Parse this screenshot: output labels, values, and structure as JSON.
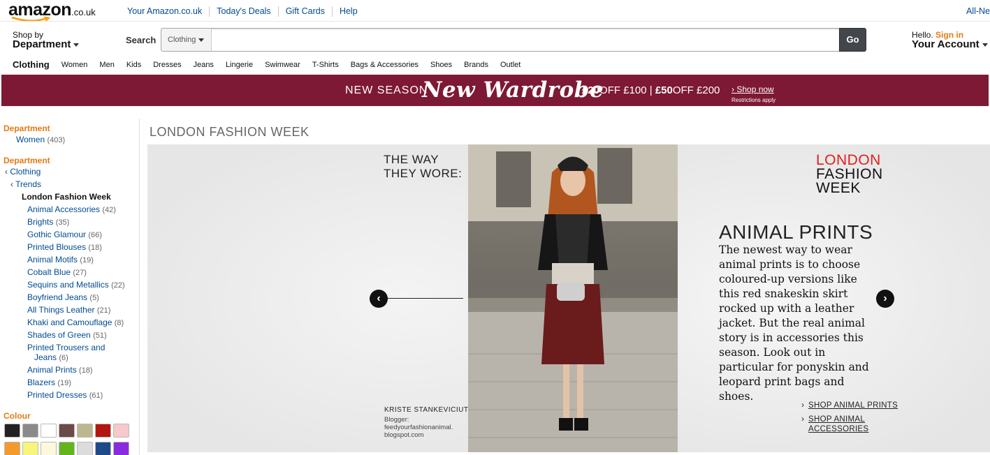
{
  "header": {
    "logo": "amazon",
    "logo_tld": ".co.uk",
    "links": [
      "Your Amazon.co.uk",
      "Today's Deals",
      "Gift Cards",
      "Help"
    ],
    "all_new": "All-Ne"
  },
  "shop_by": {
    "line1": "Shop by",
    "line2": "Department"
  },
  "search": {
    "label": "Search",
    "dept": "Clothing",
    "value": "",
    "go": "Go"
  },
  "account": {
    "hello": "Hello.",
    "signin": "Sign in",
    "your_account": "Your Account"
  },
  "subnav": [
    "Clothing",
    "Women",
    "Men",
    "Kids",
    "Dresses",
    "Jeans",
    "Lingerie",
    "Swimwear",
    "T-Shirts",
    "Bags & Accessories",
    "Shoes",
    "Brands",
    "Outlet"
  ],
  "banner": {
    "new_season": "NEW SEASON",
    "new_wardrobe": "New Wardrobe",
    "offer1_amount": "£20",
    "offer1_rest": "OFF £100",
    "sep": "|",
    "offer2_amount": "£50",
    "offer2_rest": "OFF £200",
    "shop_now": "Shop now",
    "restrictions": "Restrictions apply"
  },
  "leftnav": {
    "dept_heading": "Department",
    "women": {
      "label": "Women",
      "count": "(403)"
    },
    "dept_heading2": "Department",
    "back_clothing": "‹ Clothing",
    "back_trends": "‹ Trends",
    "current": "London Fashion Week",
    "items": [
      {
        "label": "Animal Accessories",
        "count": "(42)"
      },
      {
        "label": "Brights",
        "count": "(35)"
      },
      {
        "label": "Gothic Glamour",
        "count": "(66)"
      },
      {
        "label": "Printed Blouses",
        "count": "(18)"
      },
      {
        "label": "Animal Motifs",
        "count": "(19)"
      },
      {
        "label": "Cobalt Blue",
        "count": "(27)"
      },
      {
        "label": "Sequins and Metallics",
        "count": "(22)"
      },
      {
        "label": "Boyfriend Jeans",
        "count": "(5)"
      },
      {
        "label": "All Things Leather",
        "count": "(21)"
      },
      {
        "label": "Khaki and Camouflage",
        "count": "(8)"
      },
      {
        "label": "Shades of Green",
        "count": "(51)"
      },
      {
        "label": "Printed Trousers and",
        "label2": "Jeans",
        "count": "(6)"
      },
      {
        "label": "Animal Prints",
        "count": "(18)"
      },
      {
        "label": "Blazers",
        "count": "(19)"
      },
      {
        "label": "Printed Dresses",
        "count": "(61)"
      }
    ],
    "colour_heading": "Colour",
    "colours": [
      "#222222",
      "#8a8a8a",
      "#ffffff",
      "#6b4a48",
      "#bdb790",
      "#b3150f",
      "#f7c8cc",
      "#f39a2b",
      "#f7f57a",
      "#fbf8dc",
      "#63b51b",
      "#dcdcdc",
      "#1f4a8a",
      "#8a2be2"
    ]
  },
  "main": {
    "title": "LONDON FASHION WEEK",
    "way_line1": "THE WAY",
    "way_line2": "THEY WORE:",
    "credit_name": "KRISTE STANKEVICIUTE",
    "credit_role": "Blogger:",
    "credit_site1": "feedyourfashionanimal.",
    "credit_site2": "blogspot.com",
    "lfw_line1": "LONDON",
    "lfw_line2": "FASHION",
    "lfw_line3": "WEEK",
    "ap_title": "ANIMAL PRINTS",
    "ap_body": "The newest way to wear animal prints is to choose coloured-up versions like this red snakeskin skirt rocked up with a leather jacket. But the real animal story is in accessories this season. Look out in particular for ponyskin and leopard print bags and shoes.",
    "cta1": "SHOP ANIMAL PRINTS",
    "cta2_line1": "SHOP ANIMAL",
    "cta2_line2": "ACCESSORIES",
    "prev_arrow": "‹",
    "next_arrow": "›"
  },
  "colors": {
    "link": "#004b91",
    "orange": "#e47911",
    "banner": "#7d1934",
    "lfw_red": "#e0201d"
  }
}
